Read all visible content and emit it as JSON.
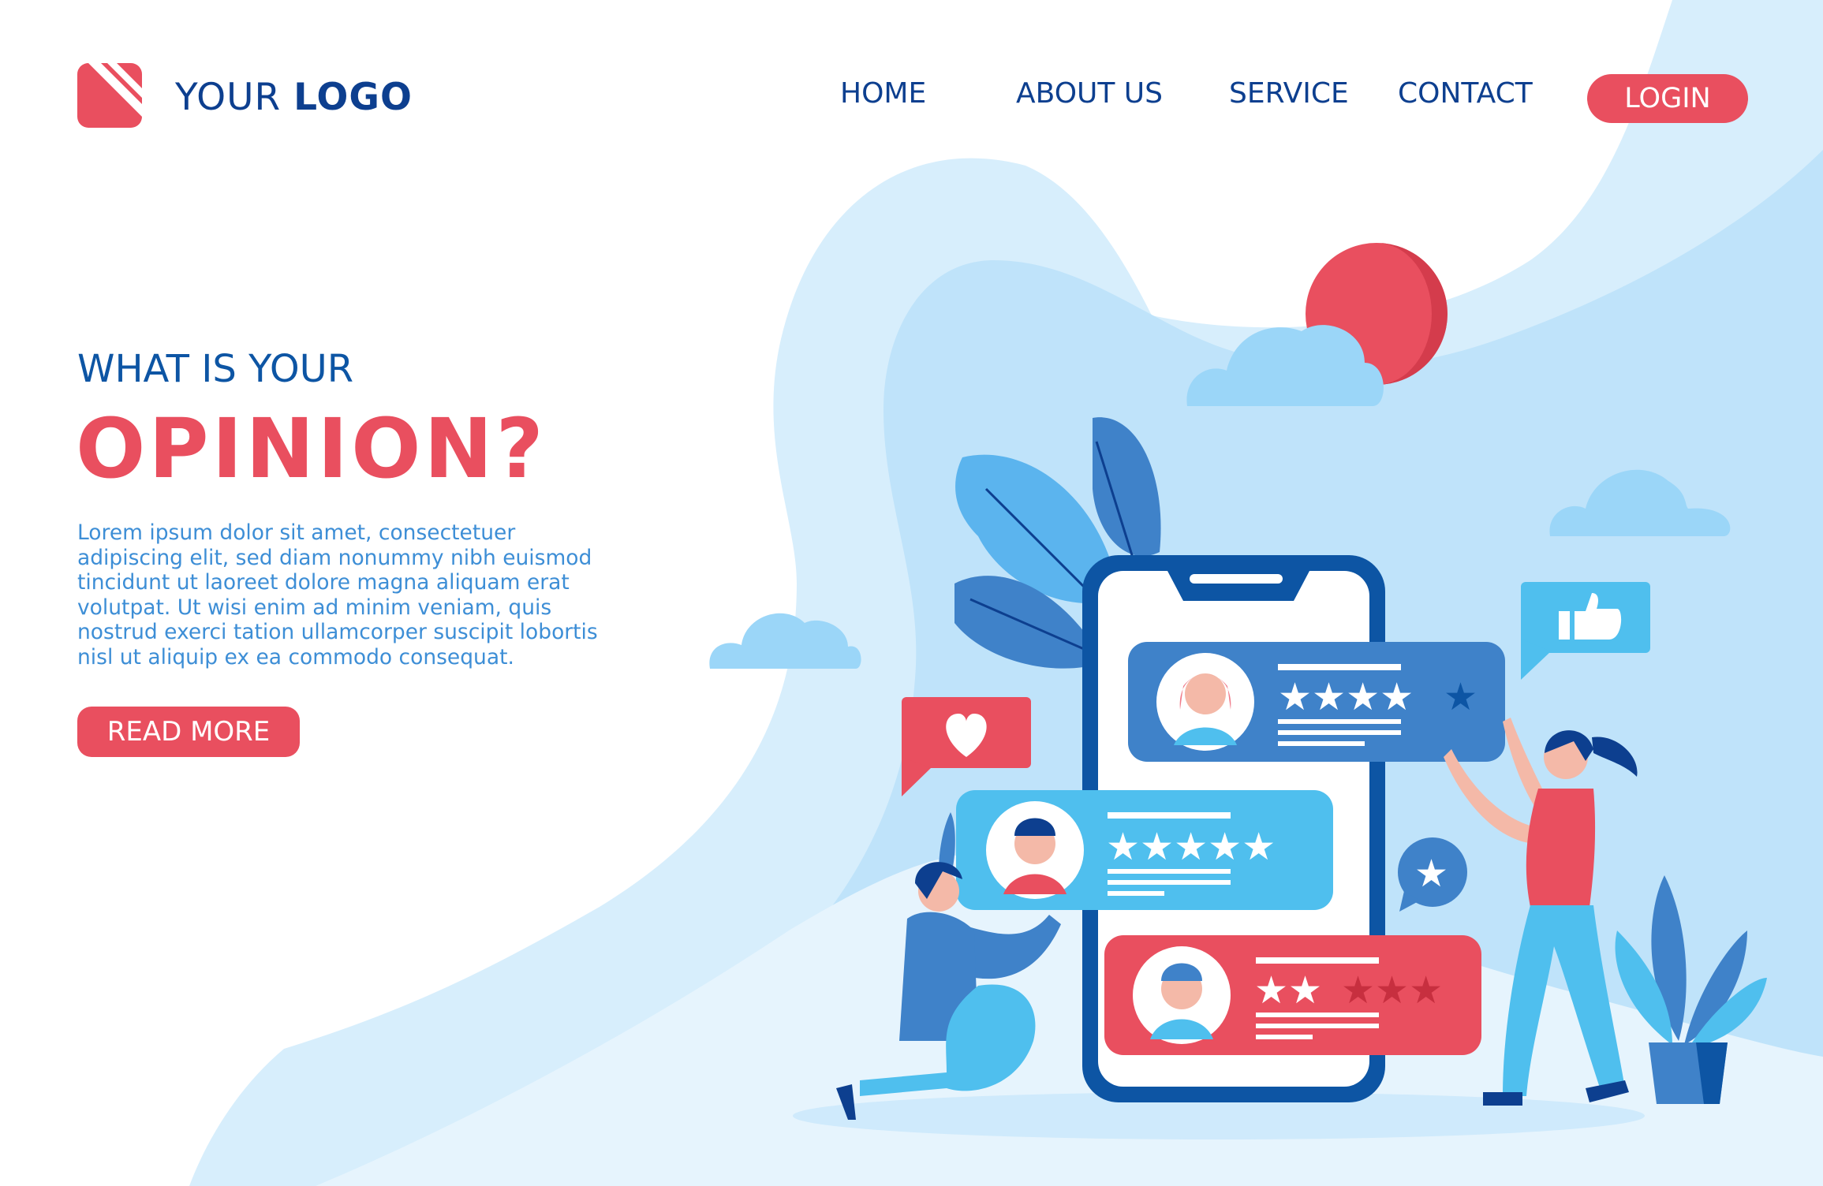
{
  "header": {
    "logo_text_light": "YOUR",
    "logo_text_bold": "LOGO",
    "nav": [
      "HOME",
      "ABOUT US",
      "SERVICE",
      "CONTACT"
    ],
    "login_label": "LOGIN"
  },
  "hero": {
    "kicker": "WHAT IS YOUR",
    "title": "OPINION?",
    "body": "Lorem ipsum dolor sit amet, consectetuer adipiscing elit, sed diam nonummy nibh euismod tincidunt ut laoreet dolore magna aliquam erat volutpat. Ut wisi enim ad minim veniam, quis nostrud exerci tation ullamcorper suscipit lobortis nisl ut aliquip ex ea commodo consequat.",
    "button_label": "READ MORE"
  },
  "illustration": {
    "reviews": [
      {
        "avatar": "woman-avatar",
        "rating": 4,
        "max": 5,
        "color": "#3f82c9"
      },
      {
        "avatar": "man-avatar",
        "rating": 5,
        "max": 5,
        "color": "#4fbfee"
      },
      {
        "avatar": "man-avatar",
        "rating": 2.5,
        "max": 5,
        "color": "#e94f5f"
      }
    ],
    "icons": [
      "heart-icon",
      "thumbs-up-icon",
      "star-icon"
    ]
  },
  "colors": {
    "brand_red": "#e94f5f",
    "navy": "#0d3f8f",
    "sky": "#c9e8fb",
    "blue": "#3f82c9"
  }
}
